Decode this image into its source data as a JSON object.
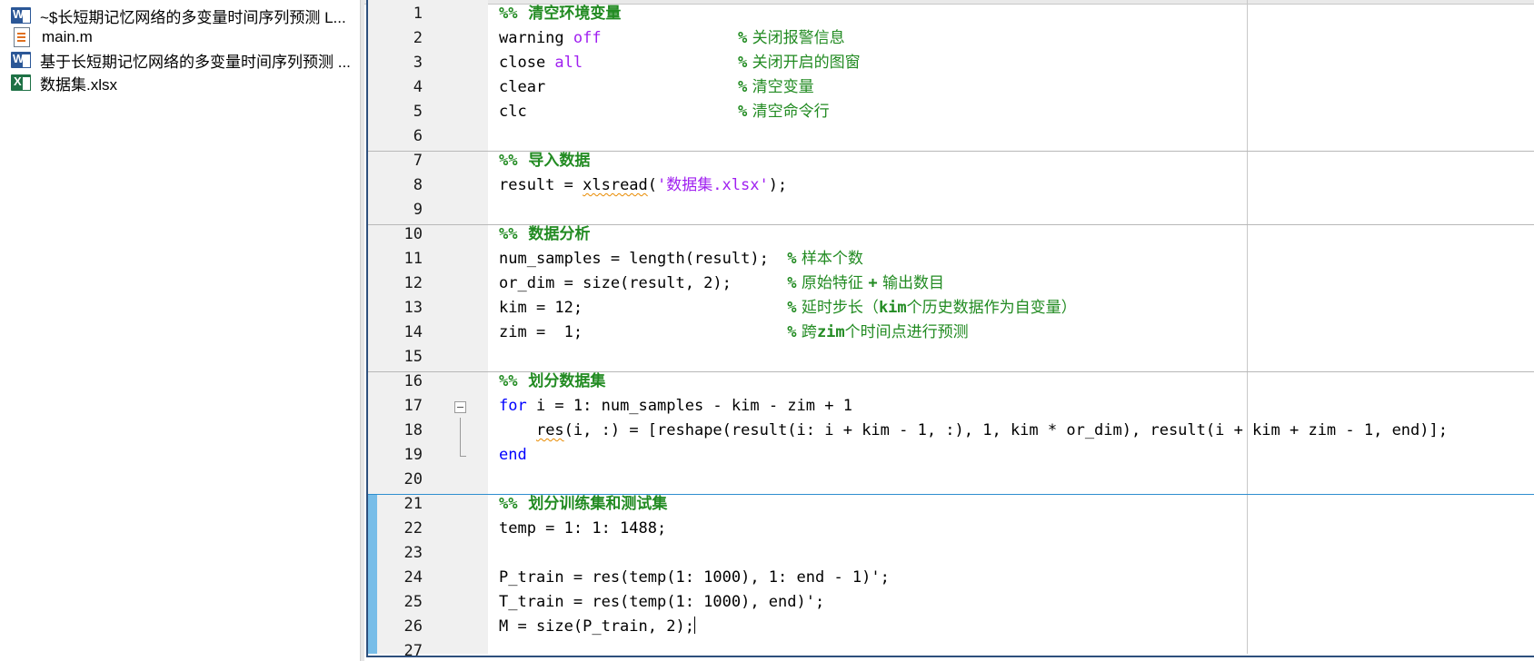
{
  "files": [
    {
      "name": "~$长短期记忆网络的多变量时间序列预测 L...",
      "icon": "word-doc-icon"
    },
    {
      "name": "main.m",
      "icon": "matlab-file-icon"
    },
    {
      "name": "基于长短期记忆网络的多变量时间序列预测 ...",
      "icon": "word-doc-icon"
    },
    {
      "name": "数据集.xlsx",
      "icon": "excel-file-icon"
    }
  ],
  "editor": {
    "colors": {
      "keyword": "#0000ff",
      "string": "#a020f0",
      "comment": "#228b22",
      "active_cell": "#78bde8"
    },
    "line_numbers": [
      "1",
      "2",
      "3",
      "4",
      "5",
      "6",
      "7",
      "8",
      "9",
      "10",
      "11",
      "12",
      "13",
      "14",
      "15",
      "16",
      "17",
      "18",
      "19",
      "20",
      "21",
      "22",
      "23",
      "24",
      "25",
      "26",
      "27"
    ],
    "lines": {
      "l1": {
        "pct": "%%",
        "text": "  清空环境变量"
      },
      "l2": {
        "code": "warning ",
        "kw": "off",
        "pct": "%",
        "cmt": " 关闭报警信息"
      },
      "l3": {
        "code": "close ",
        "kw": "all",
        "pct": "%",
        "cmt": " 关闭开启的图窗"
      },
      "l4": {
        "code": "clear",
        "pct": "%",
        "cmt": " 清空变量"
      },
      "l5": {
        "code": "clc",
        "pct": "%",
        "cmt": " 清空命令行"
      },
      "l7": {
        "pct": "%%",
        "text": "  导入数据"
      },
      "l8": {
        "a": "result = ",
        "fn": "xlsread",
        "b": "(",
        "str": "'数据集.xlsx'",
        "c": ");"
      },
      "l10": {
        "pct": "%%",
        "text": "  数据分析"
      },
      "l11": {
        "code": "num_samples = length(result);  ",
        "pct": "%",
        "cmt": " 样本个数"
      },
      "l12": {
        "code": "or_dim = size(result, 2);      ",
        "pct": "%",
        "cmt": " 原始特征 ",
        "plus": "+",
        "cmt2": " 输出数目"
      },
      "l13": {
        "code": "kim = 12;                      ",
        "pct": "%",
        "cmt": " 延时步长（",
        "bold": "kim",
        "cmt2": "个历史数据作为自变量）"
      },
      "l14": {
        "code": "zim =  1;                      ",
        "pct": "%",
        "cmt": " 跨",
        "bold": "zim",
        "cmt2": "个时间点进行预测"
      },
      "l16": {
        "pct": "%%",
        "text": "  划分数据集"
      },
      "l17": {
        "kw": "for",
        "code": " i = 1: num_samples - kim - zim + 1"
      },
      "l18": {
        "indent": "    ",
        "fn": "res",
        "code": "(i, :) = [reshape(result(i: i + kim - 1, :), 1, kim * or_dim), result(i + kim + zim - 1, end)];"
      },
      "l19": {
        "kw": "end"
      },
      "l21": {
        "pct": "%%",
        "text": "  划分训练集和测试集"
      },
      "l22": {
        "code": "temp = 1: 1: 1488;"
      },
      "l24": {
        "code": "P_train = res(temp(1: 1000), 1: end - 1)';"
      },
      "l25": {
        "code": "T_train = res(temp(1: 1000), end)';"
      },
      "l26": {
        "code": "M = size(P_train, 2);"
      }
    }
  }
}
